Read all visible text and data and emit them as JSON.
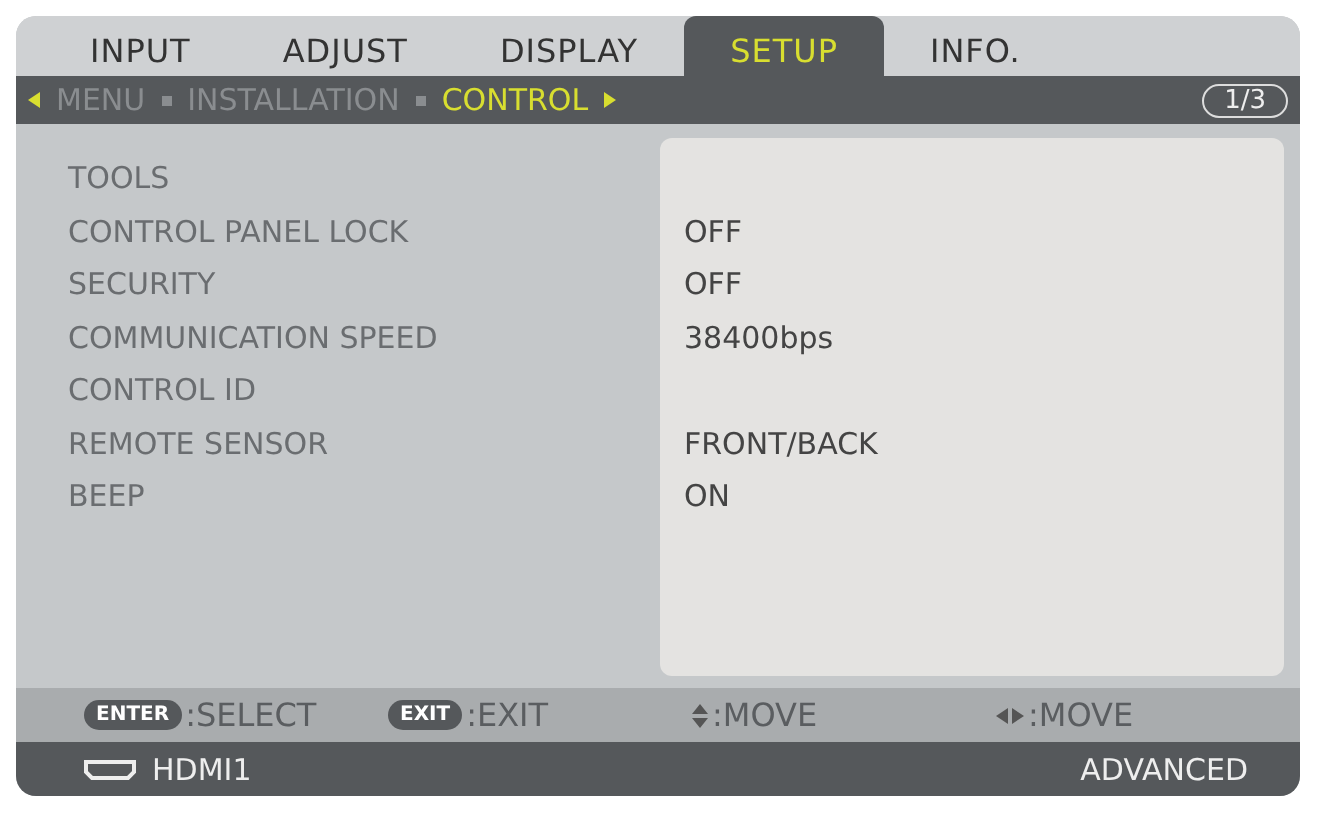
{
  "tabs": [
    {
      "label": "INPUT",
      "selected": false
    },
    {
      "label": "ADJUST",
      "selected": false
    },
    {
      "label": "DISPLAY",
      "selected": false
    },
    {
      "label": "SETUP",
      "selected": true
    },
    {
      "label": "INFO.",
      "selected": false
    }
  ],
  "breadcrumb": [
    {
      "label": "MENU",
      "selected": false
    },
    {
      "label": "INSTALLATION",
      "selected": false
    },
    {
      "label": "CONTROL",
      "selected": true
    }
  ],
  "page": "1/3",
  "rows": [
    {
      "label": "TOOLS"
    },
    {
      "label": "CONTROL PANEL LOCK",
      "value": "OFF"
    },
    {
      "label": "SECURITY",
      "value": "OFF"
    },
    {
      "label": "COMMUNICATION SPEED",
      "value": "38400bps"
    },
    {
      "label": "CONTROL ID"
    },
    {
      "label": "REMOTE SENSOR",
      "value": "FRONT/BACK"
    },
    {
      "label": "BEEP",
      "value": "ON"
    }
  ],
  "hints": [
    {
      "kind": "key",
      "key": "ENTER",
      "label": ":SELECT"
    },
    {
      "kind": "key",
      "key": "EXIT",
      "label": ":EXIT"
    },
    {
      "kind": "updown",
      "label": ":MOVE"
    },
    {
      "kind": "leftright",
      "label": ":MOVE"
    }
  ],
  "status_bar": {
    "source": "HDMI1",
    "mode": "ADVANCED"
  }
}
